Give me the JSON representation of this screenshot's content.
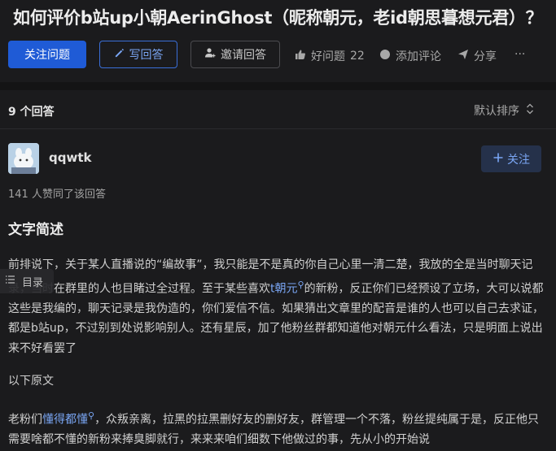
{
  "question": {
    "title": "如何评价b站up小朝AerinGhost（昵称朝元，老id朝思暮想元君）？"
  },
  "actions": {
    "follow_question": "关注问题",
    "write_answer": "写回答",
    "invite_answer": "邀请回答",
    "good_question": "好问题",
    "good_question_count": "22",
    "add_comment": "添加评论",
    "share": "分享",
    "more": "···"
  },
  "answers": {
    "count_label": "9 个回答",
    "sort_label": "默认排序"
  },
  "answer": {
    "author": "qqwtk",
    "follow_label": "关注",
    "likes_text": "141 人赞同了该回答",
    "section_title": "文字简述",
    "toc_label": "目录",
    "p1_a": "前排说下，关于某人直播说的“编故事”，我只能是不是真的你自己心里一清二楚，我放的全是当时聊天记录，当时在群里的人也目睹过全过程。至于某些喜欢",
    "p1_link": "t朝元",
    "p1_b": "的新粉，反正你们已经预设了立场，大可以说都这些是我编的，聊天记录是我伪造的，你们爱信不信。如果猜出文章里的配音是谁的人也可以自己去求证，都是b站up，不过别到处说影响别人。还有星辰，加了他粉丝群都知道他对朝元什么看法，只是明面上说出来不好看罢了",
    "p2": "以下原文",
    "p3_a": "老粉们",
    "p3_link": "懂得都懂",
    "p3_b": "，众叛亲离，拉黑的拉黑删好友的删好友，群管理一个不落，粉丝提纯属于是，反正他只需要啥都不懂的新粉来捧臭脚就行，来来来咱们细数下他做过的事，先从小的开始说"
  },
  "colors": {
    "background": "#1b1b1d",
    "primary": "#1f5bd6",
    "link": "#7aa6f4"
  }
}
